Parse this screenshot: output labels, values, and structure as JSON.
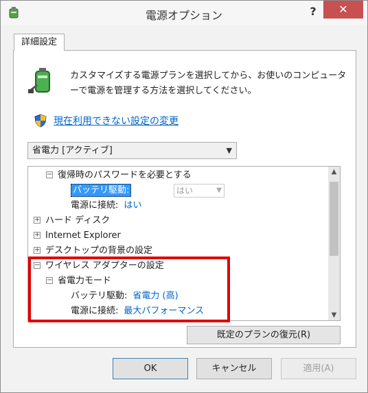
{
  "window": {
    "title": "電源オプション",
    "help_label": "?",
    "close_label": "✕"
  },
  "tab": {
    "label": "詳細設定"
  },
  "description": "カスタマイズする電源プランを選択してから、お使いのコンピューターで電源を管理する方法を選択してください。",
  "change_link": "現在利用できない設定の変更",
  "plan_select": {
    "value": "省電力 [アクティブ]"
  },
  "tree": {
    "rows": [
      {
        "label": "復帰時のパスワードを必要とする",
        "expander": "⊟"
      },
      {
        "label": "バッテリ駆動:",
        "value": "はい"
      },
      {
        "label": "電源に接続:",
        "value": "はい"
      },
      {
        "label": "ハード ディスク",
        "expander": "⊞"
      },
      {
        "label": "Internet Explorer",
        "expander": "⊞"
      },
      {
        "label": "デスクトップの背景の設定",
        "expander": "⊞"
      },
      {
        "label": "ワイヤレス アダプターの設定",
        "expander": "⊟"
      },
      {
        "label": "省電力モード",
        "expander": "⊟"
      },
      {
        "label": "バッテリ駆動:",
        "value": "省電力 (高)"
      },
      {
        "label": "電源に接続:",
        "value": "最大パフォーマンス"
      }
    ]
  },
  "buttons": {
    "restore": "既定のプランの復元(R)",
    "ok": "OK",
    "cancel": "キャンセル",
    "apply": "適用(A)"
  },
  "colors": {
    "link": "#0066cc",
    "close": "#c75050",
    "highlight": "#e00000",
    "selection": "#3399ff"
  }
}
